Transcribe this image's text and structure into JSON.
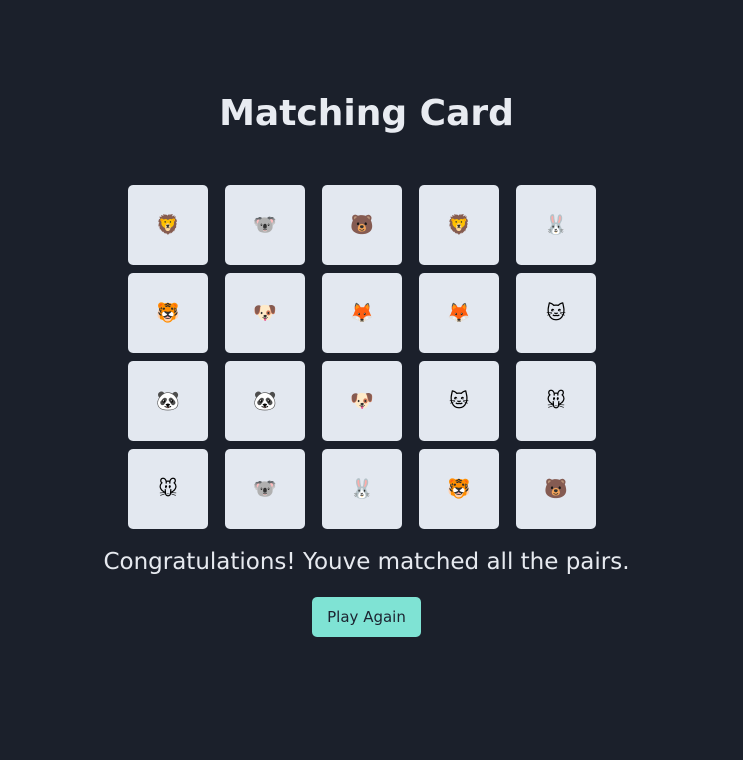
{
  "title": "Matching Card",
  "cards": [
    {
      "animal": "lion",
      "emoji": "🦁"
    },
    {
      "animal": "koala",
      "emoji": "🐨"
    },
    {
      "animal": "bear",
      "emoji": "🐻"
    },
    {
      "animal": "lion",
      "emoji": "🦁"
    },
    {
      "animal": "rabbit",
      "emoji": "🐰"
    },
    {
      "animal": "tiger",
      "emoji": "🐯"
    },
    {
      "animal": "dog",
      "emoji": "🐶"
    },
    {
      "animal": "fox",
      "emoji": "🦊"
    },
    {
      "animal": "fox",
      "emoji": "🦊"
    },
    {
      "animal": "cat",
      "emoji": "🐱"
    },
    {
      "animal": "panda",
      "emoji": "🐼"
    },
    {
      "animal": "panda",
      "emoji": "🐼"
    },
    {
      "animal": "dog",
      "emoji": "🐶"
    },
    {
      "animal": "cat",
      "emoji": "🐱"
    },
    {
      "animal": "mouse",
      "emoji": "🐭"
    },
    {
      "animal": "mouse",
      "emoji": "🐭"
    },
    {
      "animal": "koala",
      "emoji": "🐨"
    },
    {
      "animal": "rabbit",
      "emoji": "🐰"
    },
    {
      "animal": "tiger",
      "emoji": "🐯"
    },
    {
      "animal": "bear",
      "emoji": "🐻"
    }
  ],
  "message": "Congratulations! Youve matched all the pairs.",
  "play_again_label": "Play Again",
  "colors": {
    "background": "#1b202b",
    "card": "#e3e8f0",
    "accent": "#7fe3d4"
  }
}
